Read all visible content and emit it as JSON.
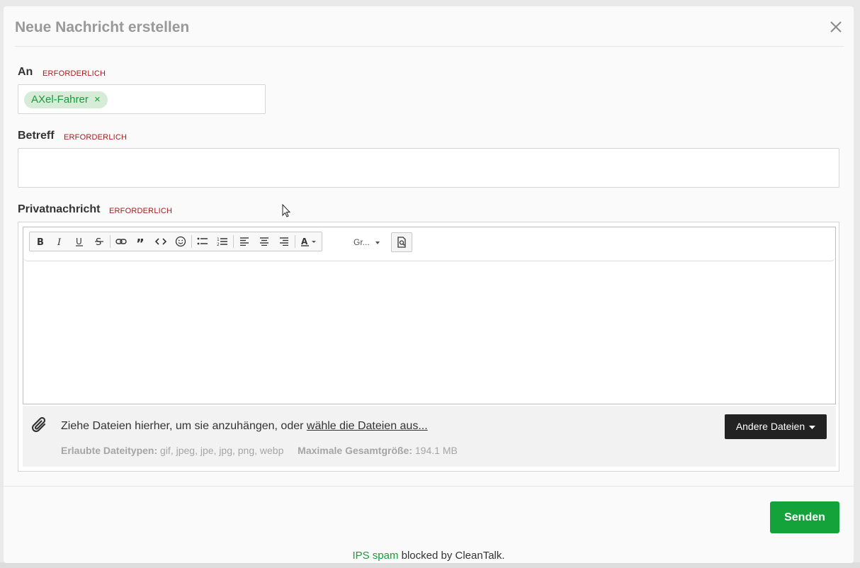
{
  "modal": {
    "title": "Neue Nachricht erstellen"
  },
  "to": {
    "label": "An",
    "required": "ERFORDERLICH",
    "token": "AXel-Fahrer",
    "token_remove": "×"
  },
  "subject": {
    "label": "Betreff",
    "required": "ERFORDERLICH",
    "value": ""
  },
  "message": {
    "label": "Privatnachricht",
    "required": "ERFORDERLICH",
    "font_select": "Gr..."
  },
  "toolbar": {
    "icons": [
      "bold-icon",
      "italic-icon",
      "underline-icon",
      "strikethrough-icon",
      "link-icon",
      "quote-icon",
      "code-icon",
      "emoji-icon",
      "bulleted-list-icon",
      "numbered-list-icon",
      "align-left-icon",
      "align-center-icon",
      "align-right-icon",
      "text-color-icon",
      "preview-icon"
    ]
  },
  "attachments": {
    "text": "Ziehe Dateien hierher, um sie anzuhängen, oder ",
    "link": "wähle die Dateien aus...",
    "allowed_label": "Erlaubte Dateitypen:",
    "allowed_value": "gif, jpeg, jpe, jpg, png, webp",
    "max_label": "Maximale Gesamtgröße:",
    "max_value": "194.1 MB",
    "other_button": "Andere Dateien"
  },
  "footer": {
    "send_button": "Senden",
    "spam_link": "IPS spam",
    "spam_text": " blocked by CleanTalk."
  },
  "colors": {
    "accent": "#14a33a",
    "required": "#a81b1b",
    "token_bg": "#d6ecd6"
  }
}
